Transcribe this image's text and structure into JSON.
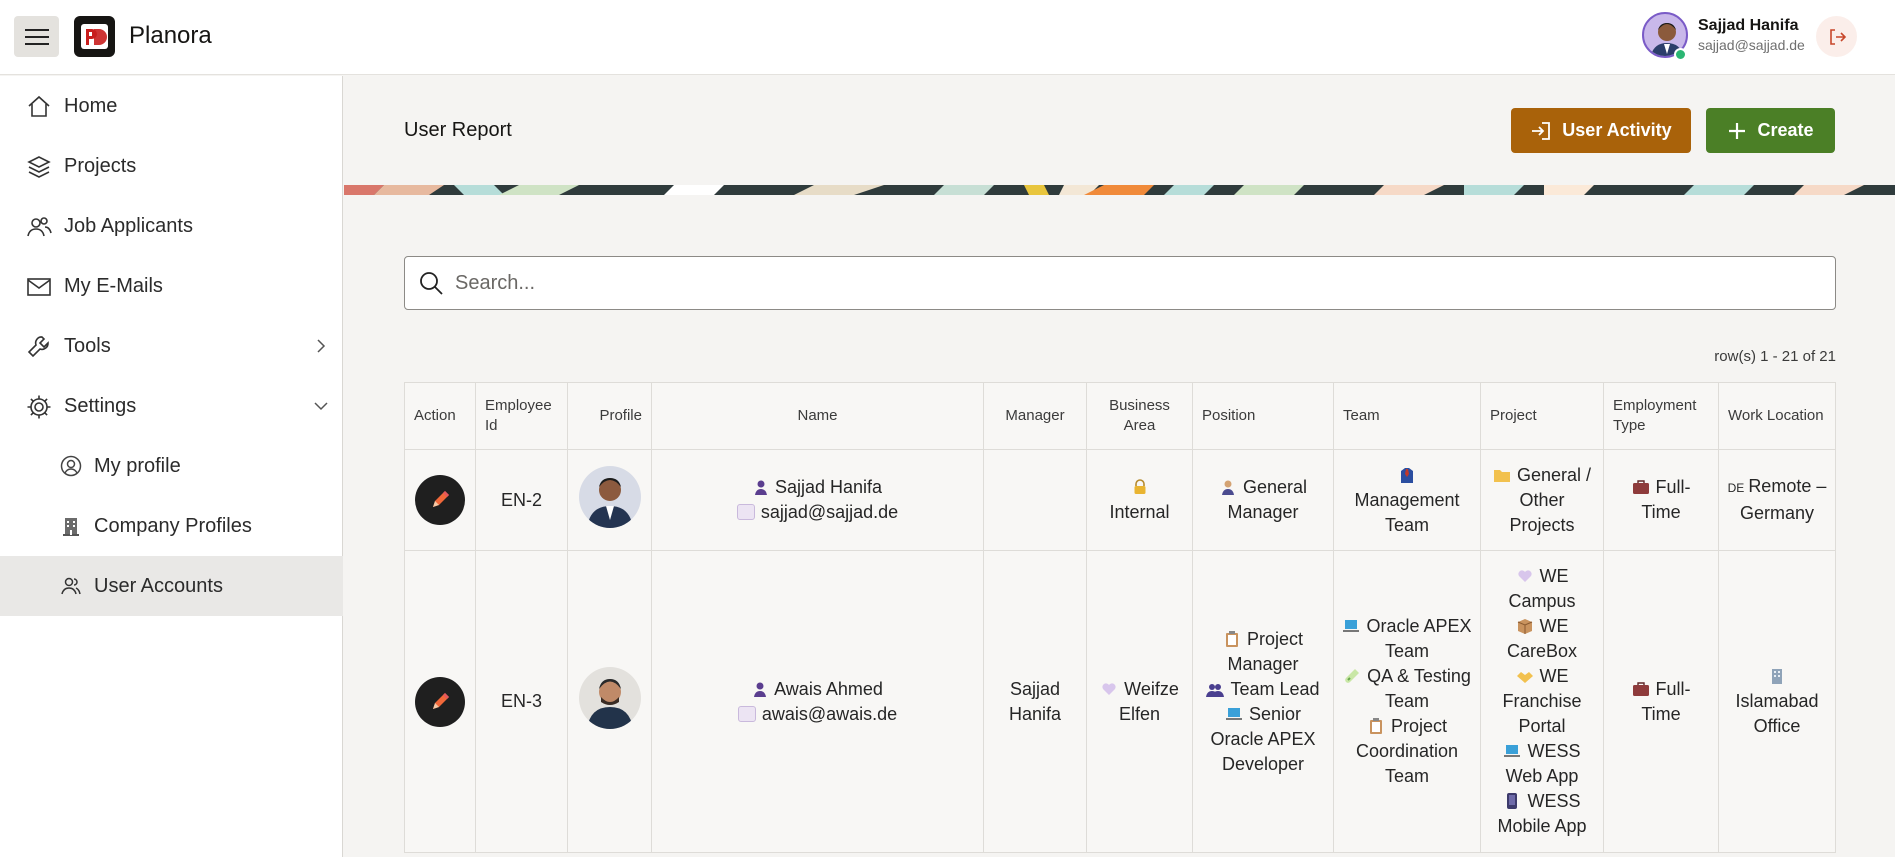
{
  "app": {
    "title": "Planora"
  },
  "user": {
    "name": "Sajjad Hanifa",
    "email": "sajjad@sajjad.de"
  },
  "nav": {
    "items": [
      {
        "label": "Home",
        "icon": "home-icon"
      },
      {
        "label": "Projects",
        "icon": "layers-icon"
      },
      {
        "label": "Job Applicants",
        "icon": "users-icon"
      },
      {
        "label": "My E-Mails",
        "icon": "mail-icon"
      },
      {
        "label": "Tools",
        "icon": "wrench-icon"
      },
      {
        "label": "Settings",
        "icon": "gear-icon"
      }
    ],
    "sub_items": [
      {
        "label": "My profile",
        "icon": "user-circle-icon"
      },
      {
        "label": "Company Profiles",
        "icon": "building-icon"
      },
      {
        "label": "User Accounts",
        "icon": "users-icon"
      }
    ]
  },
  "page": {
    "title": "User Report",
    "activity_label": "User Activity",
    "create_label": "Create",
    "search_placeholder": "Search...",
    "row_count": "row(s) 1 - 21 of 21"
  },
  "table": {
    "headers": {
      "action": "Action",
      "employee_id": "Employee Id",
      "profile": "Profile",
      "name": "Name",
      "manager": "Manager",
      "business_area": "Business Area",
      "position": "Position",
      "team": "Team",
      "project": "Project",
      "employment_type": "Employment Type",
      "work_location": "Work Location"
    },
    "rows": [
      {
        "employee_id": "EN-2",
        "name": "Sajjad Hanifa",
        "email": "sajjad@sajjad.de",
        "manager": "",
        "business_area": "Internal",
        "position": [
          "General Manager"
        ],
        "team": [
          "Management Team"
        ],
        "project": [
          "General / Other Projects"
        ],
        "employment_type": "Full-Time",
        "work_location_prefix": "DE",
        "work_location": "Remote – Germany"
      },
      {
        "employee_id": "EN-3",
        "name": "Awais Ahmed",
        "email": "awais@awais.de",
        "manager": "Sajjad Hanifa",
        "business_area": "Weifze Elfen",
        "position": [
          "Project Manager",
          "Team Lead",
          "Senior Oracle APEX Developer"
        ],
        "team": [
          "Oracle APEX Team",
          "QA & Testing Team",
          "Project Coordination Team"
        ],
        "project": [
          "WE Campus",
          "WE CareBox",
          "WE Franchise Portal",
          "WESS Web App",
          "WESS Mobile App"
        ],
        "employment_type": "Full-Time",
        "work_location": "Islamabad Office"
      }
    ]
  },
  "colors": {
    "activity": "#a9620a",
    "create": "#4b7f26"
  }
}
